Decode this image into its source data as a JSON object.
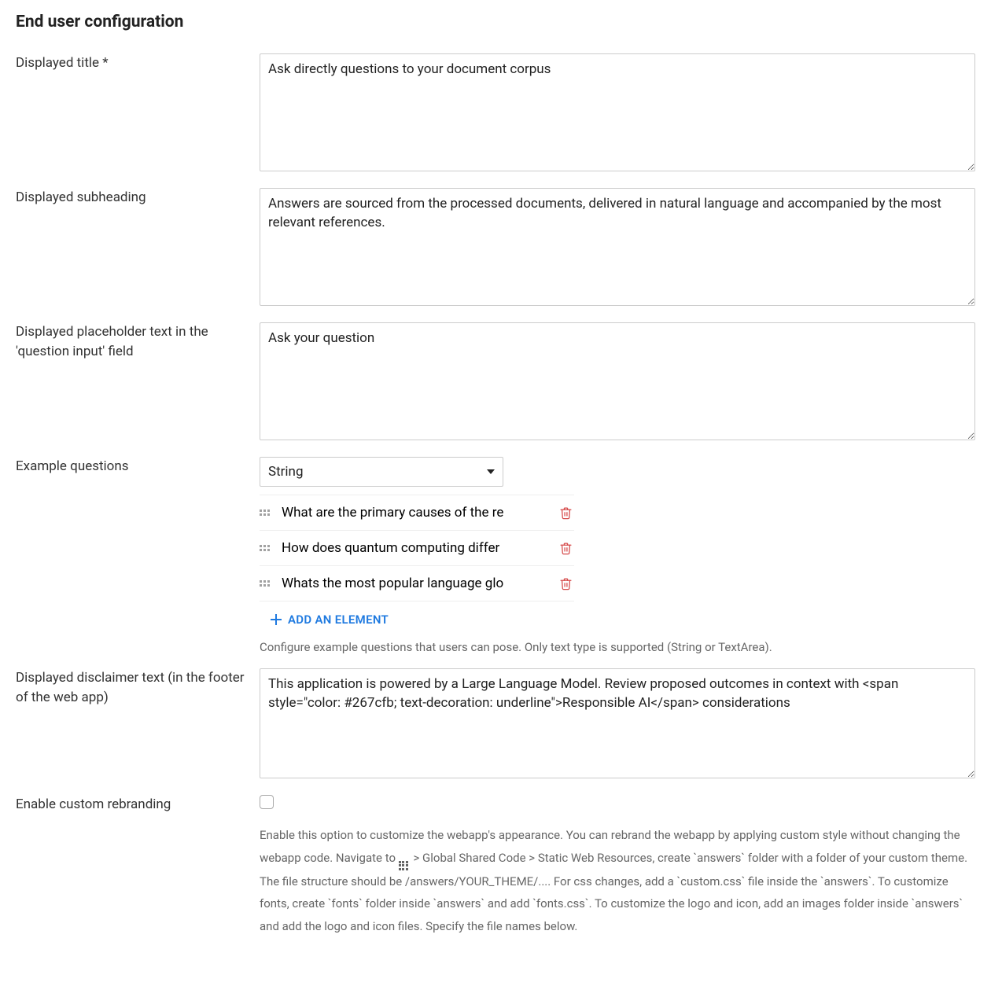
{
  "section_title": "End user configuration",
  "fields": {
    "displayed_title": {
      "label": "Displayed title *",
      "value": "Ask directly questions to your document corpus"
    },
    "displayed_subheading": {
      "label": "Displayed subheading",
      "value": "Answers are sourced from the processed documents, delivered in natural language and accompanied by the most relevant references."
    },
    "placeholder_text": {
      "label": "Displayed placeholder text in the 'question input' field",
      "value": "Ask your question"
    },
    "example_questions": {
      "label": "Example questions",
      "type_select_value": "String",
      "items": [
        "What are the primary causes of the re",
        "How does quantum computing differ",
        "Whats the most popular language glo"
      ],
      "add_element_label": "ADD AN ELEMENT",
      "help_text": "Configure example questions that users can pose. Only text type is supported (String or TextArea)."
    },
    "disclaimer": {
      "label": "Displayed disclaimer text (in the footer of the web app)",
      "value": "This application is powered by a Large Language Model. Review proposed outcomes in context with <span style=\"color: #267cfb; text-decoration: underline\">Responsible AI</span> considerations"
    },
    "rebranding": {
      "label": "Enable custom rebranding",
      "checked": false,
      "help_parts": {
        "p1": "Enable this option to customize the webapp's appearance. You can rebrand the webapp by applying custom style without changing the webapp code. Navigate to ",
        "p2": " > Global Shared Code > Static Web Resources, create `answers` folder with a folder of your custom theme. The file structure should be /answers/YOUR_THEME/.... For css changes, add a `custom.css` file inside the `answers`. To customize fonts, create `fonts` folder inside `answers` and add `fonts.css`. To customize the logo and icon, add an images folder inside `answers` and add the logo and icon files. Specify the file names below."
      }
    }
  }
}
